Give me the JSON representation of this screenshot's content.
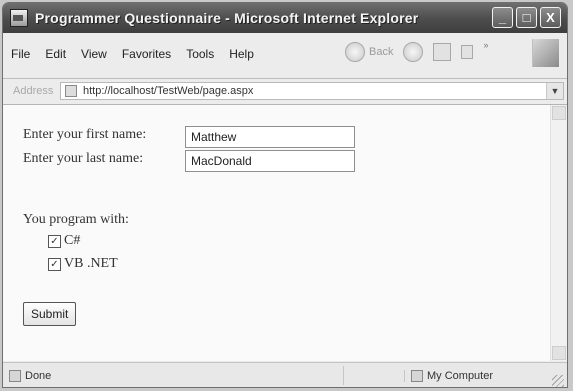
{
  "window": {
    "title": "Programmer Questionnaire - Microsoft Internet Explorer",
    "controls": [
      "_",
      "□",
      "X"
    ]
  },
  "menu": {
    "items": [
      "File",
      "Edit",
      "View",
      "Favorites",
      "Tools",
      "Help"
    ],
    "back_label": "Back"
  },
  "address": {
    "label": "Address",
    "url": "http://localhost/TestWeb/page.aspx"
  },
  "form": {
    "first_name_label": "Enter your first name:",
    "first_name_value": "Matthew",
    "last_name_label": "Enter your last name:",
    "last_name_value": "MacDonald",
    "program_with_label": "You program with:",
    "options": [
      {
        "label": "C#",
        "checked": true
      },
      {
        "label": "VB .NET",
        "checked": true
      }
    ],
    "submit_label": "Submit"
  },
  "status": {
    "left": "Done",
    "zone": "My Computer"
  }
}
